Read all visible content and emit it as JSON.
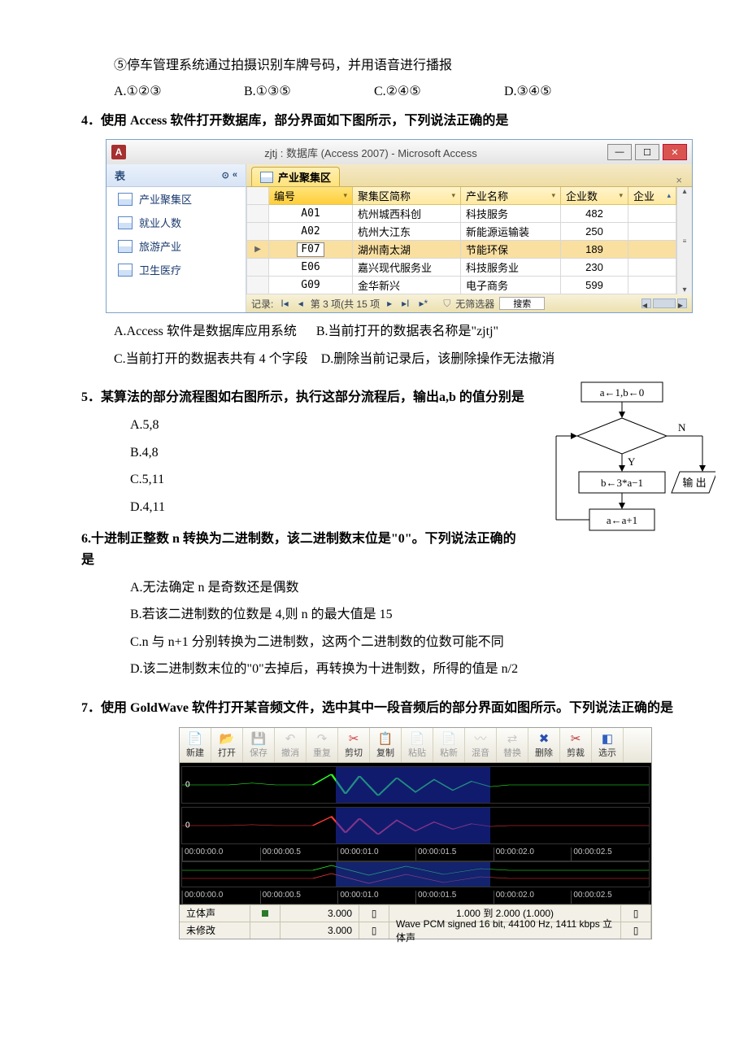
{
  "q_item5": "⑤停车管理系统通过拍摄识别车牌号码，并用语音进行播报",
  "q3_options": [
    "A.①②③",
    "B.①③⑤",
    "C.②④⑤",
    "D.③④⑤"
  ],
  "q4_title": "4．使用 Access 软件打开数据库，部分界面如下图所示，下列说法正确的是",
  "access": {
    "title": "zjtj : 数据库 (Access 2007) - Microsoft Access",
    "nav_header": "表",
    "nav_items": [
      "产业聚集区",
      "就业人数",
      "旅游产业",
      "卫生医疗"
    ],
    "tab": "产业聚集区",
    "columns": [
      "编号",
      "聚集区简称",
      "产业名称",
      "企业数",
      "企业"
    ],
    "rows": [
      {
        "id": "A01",
        "abbr": "杭州城西科创",
        "ind": "科技服务",
        "num": "482"
      },
      {
        "id": "A02",
        "abbr": "杭州大江东",
        "ind": "新能源运输装",
        "num": "250"
      },
      {
        "id": "F07",
        "abbr": "湖州南太湖",
        "ind": "节能环保",
        "num": "189",
        "sel": true,
        "edit": true
      },
      {
        "id": "E06",
        "abbr": "嘉兴现代服务业",
        "ind": "科技服务业",
        "num": "230"
      },
      {
        "id": "G09",
        "abbr": "金华新兴",
        "ind": "电子商务",
        "num": "599"
      }
    ],
    "record_label_pre": "记录: ",
    "record_text": "第 3 项(共 15 项",
    "filter": "无筛选器",
    "search": "搜索"
  },
  "q4_opt_a": "A.Access 软件是数据库应用系统",
  "q4_opt_b": "B.当前打开的数据表名称是\"zjtj\"",
  "q4_opt_c": "C.当前打开的数据表共有 4 个字段",
  "q4_opt_d": "D.删除当前记录后，该删除操作无法撤消",
  "q5_title": "5．某算法的部分流程图如右图所示，执行这部分流程后，输出a,b 的值分别是",
  "q5_opts": [
    "A.5,8",
    "B.4,8",
    "C.5,11",
    "D.4,11"
  ],
  "flowchart": {
    "init": "a←1,b←0",
    "cond_branch_y": "Y",
    "cond_branch_n": "N",
    "proc_b": "b←3*a−1",
    "output": "输  出",
    "proc_a": "a←a+1"
  },
  "q6_title": "6.十进制正整数 n 转换为二进制数，该二进制数末位是\"0\"。下列说法正确的是",
  "q6_opts": [
    "A.无法确定 n 是奇数还是偶数",
    "B.若该二进制数的位数是 4,则 n 的最大值是 15",
    "C.n 与 n+1 分别转换为二进制数，这两个二进制数的位数可能不同",
    "D.该二进制数末位的\"0\"去掉后，再转换为十进制数，所得的值是 n/2"
  ],
  "q7_title": "7．使用 GoldWave 软件打开某音频文件，选中其中一段音频后的部分界面如图所示。下列说法正确的是",
  "goldwave": {
    "toolbar": [
      {
        "label": "新建",
        "icon": "📄",
        "cls": "ic-new"
      },
      {
        "label": "打开",
        "icon": "📂",
        "cls": "ic-open"
      },
      {
        "label": "保存",
        "icon": "💾",
        "cls": "ic-save",
        "disabled": true
      },
      {
        "label": "撤消",
        "icon": "↶",
        "cls": "ic-undo",
        "disabled": true
      },
      {
        "label": "重复",
        "icon": "↷",
        "cls": "ic-redo",
        "disabled": true
      },
      {
        "label": "剪切",
        "icon": "✂",
        "cls": "ic-cut"
      },
      {
        "label": "复制",
        "icon": "📋",
        "cls": "ic-copy"
      },
      {
        "label": "粘贴",
        "icon": "📄",
        "cls": "ic-paste",
        "disabled": true
      },
      {
        "label": "粘新",
        "icon": "📄",
        "cls": "ic-pnew",
        "disabled": true
      },
      {
        "label": "混音",
        "icon": "〰",
        "cls": "ic-mix",
        "disabled": true
      },
      {
        "label": "替换",
        "icon": "⇄",
        "cls": "ic-rep",
        "disabled": true
      },
      {
        "label": "删除",
        "icon": "✖",
        "cls": "ic-del"
      },
      {
        "label": "剪裁",
        "icon": "✂",
        "cls": "ic-trim"
      },
      {
        "label": "选示",
        "icon": "◧",
        "cls": "ic-sel"
      }
    ],
    "ruler": [
      "00:00:00.0",
      "00:00:00.5",
      "00:00:01.0",
      "00:00:01.5",
      "00:00:02.0",
      "00:00:02.5"
    ],
    "status1": {
      "mode": "立体声",
      "len": "3.000",
      "sel": "1.000 到 2.000 (1.000)"
    },
    "status2": {
      "mod": "未修改",
      "len": "3.000",
      "fmt": "Wave PCM signed 16 bit, 44100 Hz, 1411 kbps 立体声"
    }
  }
}
